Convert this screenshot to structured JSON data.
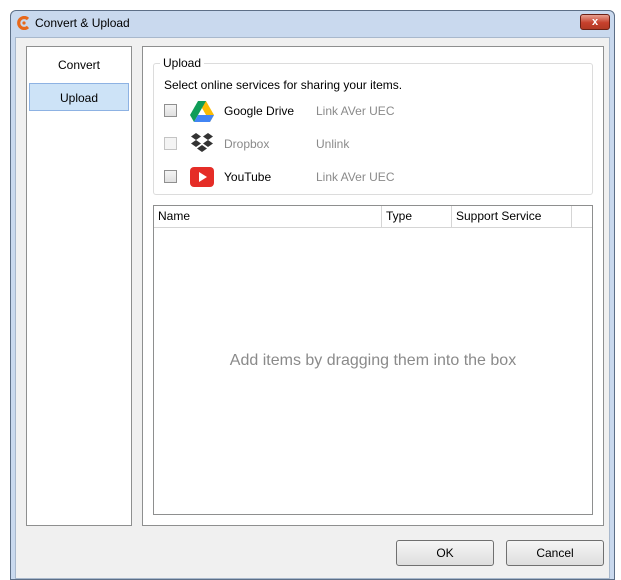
{
  "window": {
    "title": "Convert & Upload",
    "close_glyph": "x"
  },
  "sidebar": {
    "items": [
      {
        "label": "Convert"
      },
      {
        "label": "Upload"
      }
    ]
  },
  "upload": {
    "group_label": "Upload",
    "description": "Select online services for sharing your items.",
    "services": [
      {
        "name": "Google Drive",
        "icon": "google-drive-icon",
        "link": "Link AVer UEC",
        "enabled": true
      },
      {
        "name": "Dropbox",
        "icon": "dropbox-icon",
        "link": "Unlink",
        "enabled": false
      },
      {
        "name": "YouTube",
        "icon": "youtube-icon",
        "link": "Link AVer UEC",
        "enabled": true
      }
    ]
  },
  "list": {
    "columns": [
      {
        "label": "Name"
      },
      {
        "label": "Type"
      },
      {
        "label": "Support Service"
      }
    ],
    "empty_hint": "Add items by dragging them into the box"
  },
  "buttons": {
    "ok": "OK",
    "cancel": "Cancel"
  },
  "colors": {
    "selected_bg": "#cde3f7",
    "youtube_red": "#e52d27",
    "dropbox_icon": "#333333"
  }
}
